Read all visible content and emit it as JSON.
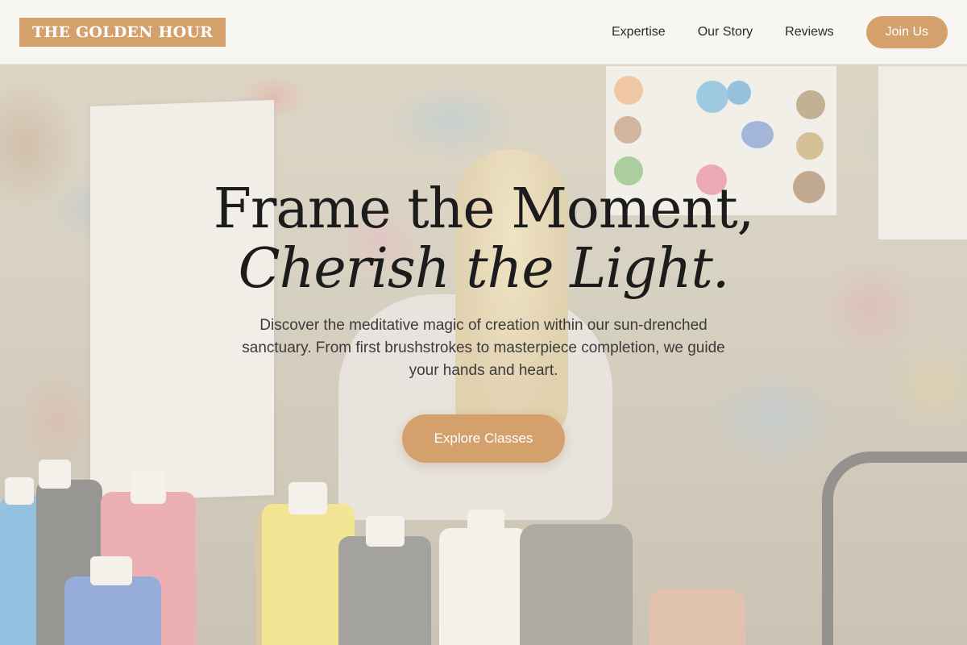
{
  "brand": {
    "name": "THE GOLDEN HOUR",
    "accent_color": "#d4a06b"
  },
  "nav": {
    "links": [
      {
        "label": "Expertise"
      },
      {
        "label": "Our Story"
      },
      {
        "label": "Reviews"
      }
    ],
    "cta_label": "Join Us"
  },
  "hero": {
    "headline_line1": "Frame the Moment,",
    "headline_line2": "Cherish the Light.",
    "subtitle": "Discover the meditative magic of creation within our sun-drenched sanctuary. From first brushstrokes to masterpiece completion, we guide your hands and heart.",
    "cta_label": "Explore Classes"
  }
}
